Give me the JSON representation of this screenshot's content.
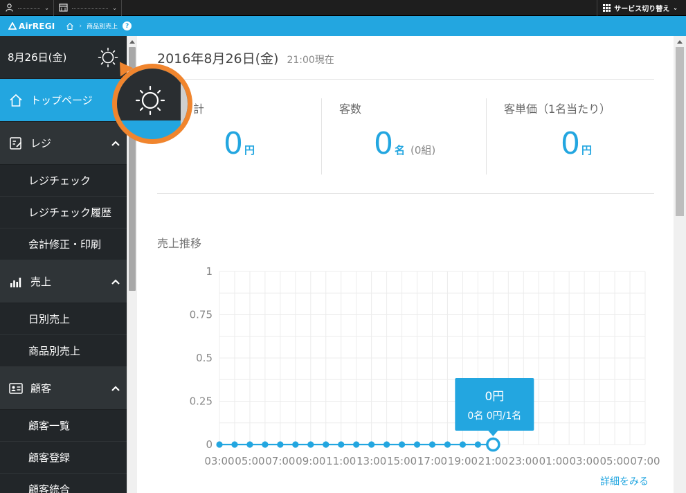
{
  "topbar": {
    "account_1": "",
    "account_2": "",
    "service_switch": "サービス切り替え"
  },
  "navbar": {
    "logo": "AirREGI",
    "breadcrumb": "商品別売上",
    "help": "?"
  },
  "sidebar": {
    "date": "8月26日(金)",
    "top_page": "トップページ",
    "sections": [
      {
        "label": "レジ",
        "items": [
          "レジチェック",
          "レジチェック履歴",
          "会計修正・印刷"
        ]
      },
      {
        "label": "売上",
        "items": [
          "日別売上",
          "商品別売上"
        ]
      },
      {
        "label": "顧客",
        "items": [
          "顧客一覧",
          "顧客登録",
          "顧客統合"
        ]
      }
    ]
  },
  "main": {
    "date": "2016年8月26日(金)",
    "time": "21:00現在",
    "stats": {
      "total": {
        "label": "計",
        "value": "0",
        "unit": "円"
      },
      "customers": {
        "label": "客数",
        "value": "0",
        "unit": "名",
        "sub": "(0組)"
      },
      "unit_price": {
        "label": "客単価（1名当たり）",
        "value": "0",
        "unit": "円"
      }
    },
    "chart_title": "売上推移",
    "tooltip": {
      "line1": "0円",
      "line2": "0名 0円/1名"
    },
    "detail_link": "詳細をみる"
  },
  "colors": {
    "accent": "#23a6e0",
    "highlight": "#f0852e",
    "sidebar": "#2f3437"
  },
  "chart_data": {
    "type": "line",
    "title": "売上推移",
    "x": [
      "03:00",
      "04:00",
      "05:00",
      "06:00",
      "07:00",
      "08:00",
      "09:00",
      "10:00",
      "11:00",
      "12:00",
      "13:00",
      "14:00",
      "15:00",
      "16:00",
      "17:00",
      "18:00",
      "19:00",
      "20:00",
      "21:00"
    ],
    "values": [
      0,
      0,
      0,
      0,
      0,
      0,
      0,
      0,
      0,
      0,
      0,
      0,
      0,
      0,
      0,
      0,
      0,
      0,
      0
    ],
    "x_tick_labels": [
      "03:00",
      "05:00",
      "07:00",
      "09:00",
      "11:00",
      "13:00",
      "15:00",
      "17:00",
      "19:00",
      "21:00",
      "23:00",
      "01:00",
      "03:00",
      "05:00",
      "07:00"
    ],
    "y_ticks": [
      "1",
      "0.75",
      "0.5",
      "0.25",
      "0"
    ],
    "ylim": [
      0,
      1
    ],
    "grid": true,
    "highlight_index": 18
  }
}
